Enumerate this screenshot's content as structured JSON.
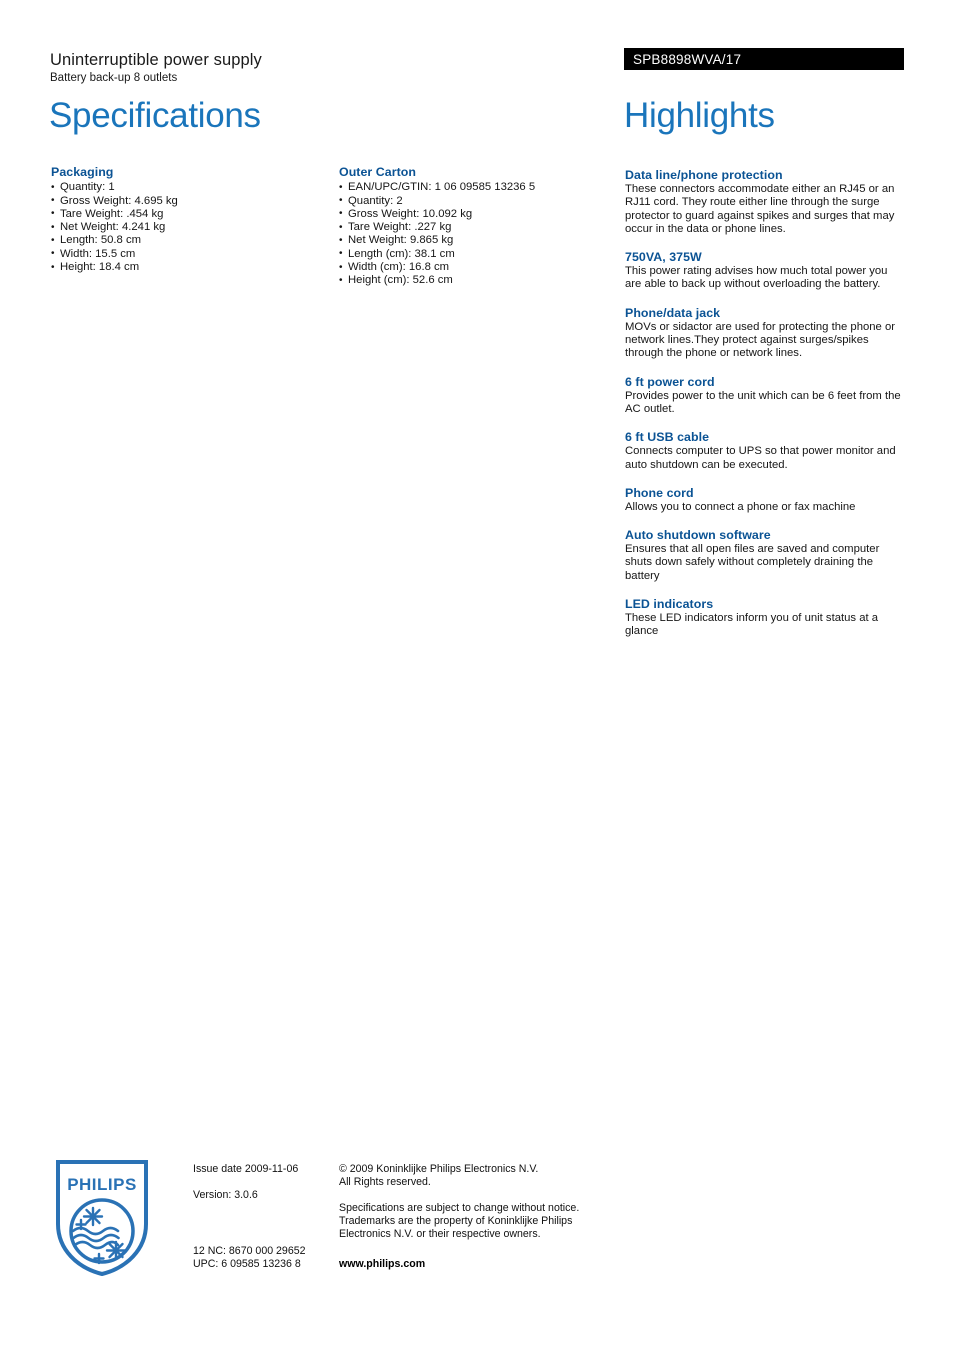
{
  "header": {
    "product_title": "Uninterruptible power supply",
    "product_subtitle": "Battery back-up 8 outlets",
    "product_code": "SPB8898WVA/17",
    "specifications_title": "Specifications",
    "highlights_title": "Highlights"
  },
  "specifications": {
    "packaging": {
      "heading": "Packaging",
      "items": [
        "Quantity: 1",
        "Gross Weight: 4.695 kg",
        "Tare Weight: .454 kg",
        "Net Weight: 4.241 kg",
        "Length: 50.8 cm",
        "Width: 15.5 cm",
        "Height: 18.4 cm"
      ]
    },
    "outer_carton": {
      "heading": "Outer Carton",
      "items": [
        "EAN/UPC/GTIN: 1 06 09585 13236 5",
        "Quantity: 2",
        "Gross Weight: 10.092 kg",
        "Tare Weight: .227 kg",
        "Net Weight: 9.865 kg",
        "Length (cm): 38.1 cm",
        "Width (cm): 16.8 cm",
        "Height (cm): 52.6 cm"
      ]
    }
  },
  "highlights": [
    {
      "title": "Data line/phone protection",
      "description": "These connectors accommodate either an RJ45 or an RJ11 cord. They route either line through the surge protector to guard against spikes and surges that may occur in the data or phone lines."
    },
    {
      "title": "750VA, 375W",
      "description": "This power rating advises how much total power you are able to back up without overloading the battery."
    },
    {
      "title": "Phone/data jack",
      "description": "MOVs or sidactor are used for protecting the phone or network lines.They protect against surges/spikes through the phone or network lines."
    },
    {
      "title": "6 ft power cord",
      "description": "Provides power to the unit which can be 6 feet from the AC outlet."
    },
    {
      "title": "6 ft USB cable",
      "description": "Connects computer to UPS so that power monitor and auto shutdown can be executed."
    },
    {
      "title": "Phone cord",
      "description": "Allows you to connect a phone or fax machine"
    },
    {
      "title": "Auto shutdown software",
      "description": "Ensures that all open files are saved and computer shuts down safely without completely draining the battery"
    },
    {
      "title": "LED indicators",
      "description": "These LED indicators inform you of unit status at a glance"
    }
  ],
  "footer": {
    "logo_wordmark": "PHILIPS",
    "issue_date": "Issue date 2009-11-06",
    "version": "Version: 3.0.6",
    "copyright_line1": "© 2009 Koninklijke Philips Electronics N.V.",
    "copyright_line2": "All Rights reserved.",
    "disclaimer_line1": "Specifications are subject to change without notice.",
    "disclaimer_line2": "Trademarks are the property of Koninklijke Philips",
    "disclaimer_line3": "Electronics N.V. or their respective owners.",
    "nc_code": "12 NC: 8670 000 29652",
    "upc_code": "UPC: 6 09585 13236 8",
    "website": "www.philips.com"
  },
  "colors": {
    "title_blue": "#1a75bb",
    "heading_blue": "#0b5394",
    "badge_bg": "#000000"
  }
}
